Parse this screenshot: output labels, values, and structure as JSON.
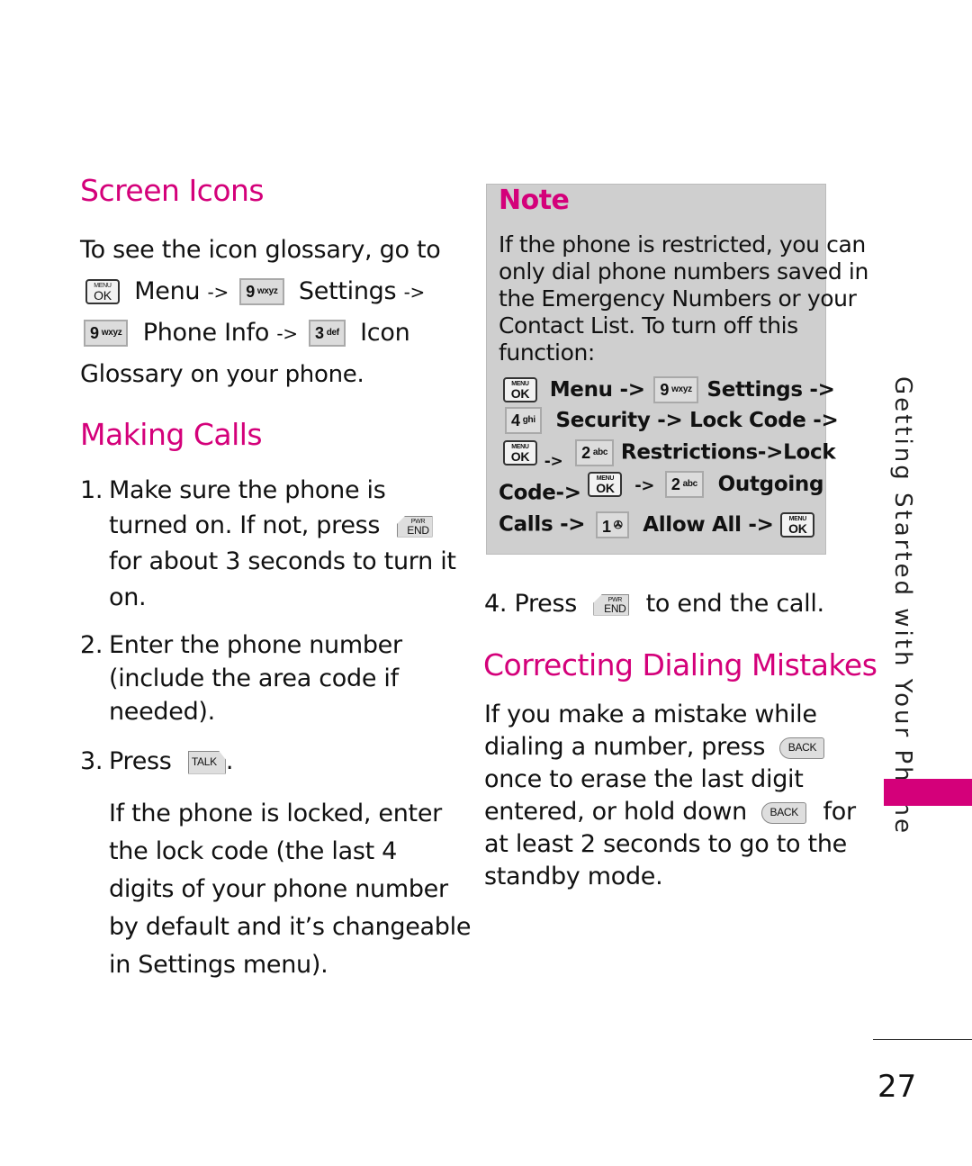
{
  "colors": {
    "accent": "#d4007a",
    "note_bg": "#cfcfcf",
    "text": "#111111"
  },
  "screen_icons": {
    "heading": "Screen Icons",
    "line1": "To see the icon glossary, go to",
    "menu_key": {
      "small": "MENU",
      "big": "OK"
    },
    "menu": "Menu",
    "arrow": "->",
    "key9": {
      "num": "9",
      "letters": "wxyz"
    },
    "settings": "Settings",
    "phone_info": "Phone Info",
    "key3": {
      "num": "3",
      "letters": "def"
    },
    "icon": "Icon",
    "glossary": "Glossary",
    "on_your_phone": "on your phone."
  },
  "making_calls": {
    "heading": "Making Calls",
    "step1": {
      "num": "1.",
      "line1": "Make sure the phone is",
      "line2": "turned on. If not, press",
      "line3": "for about 3 seconds to turn it",
      "line4": "on."
    },
    "end_key": {
      "small": "PWR",
      "big": "END"
    },
    "step2": {
      "num": "2.",
      "line1": "Enter the phone number",
      "line2": "(include the area code if",
      "line3": "needed)."
    },
    "step3": {
      "num": "3.",
      "text": "Press",
      "key": "TALK",
      "period": "."
    },
    "locked": [
      "If the phone is locked, enter",
      "the lock code (the last 4",
      "digits of your phone number",
      "by default and it’s changeable",
      "in Settings menu)."
    ]
  },
  "note": {
    "title": "Note",
    "lines": [
      "If the phone is restricted, you can",
      "only dial phone numbers saved in",
      "the Emergency Numbers or your",
      "Contact List. To turn off this",
      "function:"
    ],
    "menu": "Menu ->",
    "settings": "Settings ->",
    "key4": {
      "num": "4",
      "letters": "ghi"
    },
    "security": "Security -> Lock Code ->",
    "arrow": "->",
    "key2": {
      "num": "2",
      "letters": "abc"
    },
    "restrictions": "Restrictions->Lock",
    "code": "Code->",
    "outgoing": "Outgoing",
    "calls": "Calls ->",
    "key1": {
      "num": "1"
    },
    "allow_all": "Allow All ->"
  },
  "step4": {
    "num": "4.",
    "text": "Press",
    "after": "to end the call."
  },
  "correcting": {
    "heading": "Correcting Dialing Mistakes",
    "line1": "If you make a mistake while",
    "line2": "dialing a number, press",
    "back_key": "BACK",
    "line3": "once to erase the last digit",
    "line4": "entered, or hold down",
    "line4b": "for",
    "line5": "at least 2 seconds to go to the",
    "line6": "standby mode."
  },
  "side_label": "Getting Started with Your Phone",
  "page_number": "27"
}
